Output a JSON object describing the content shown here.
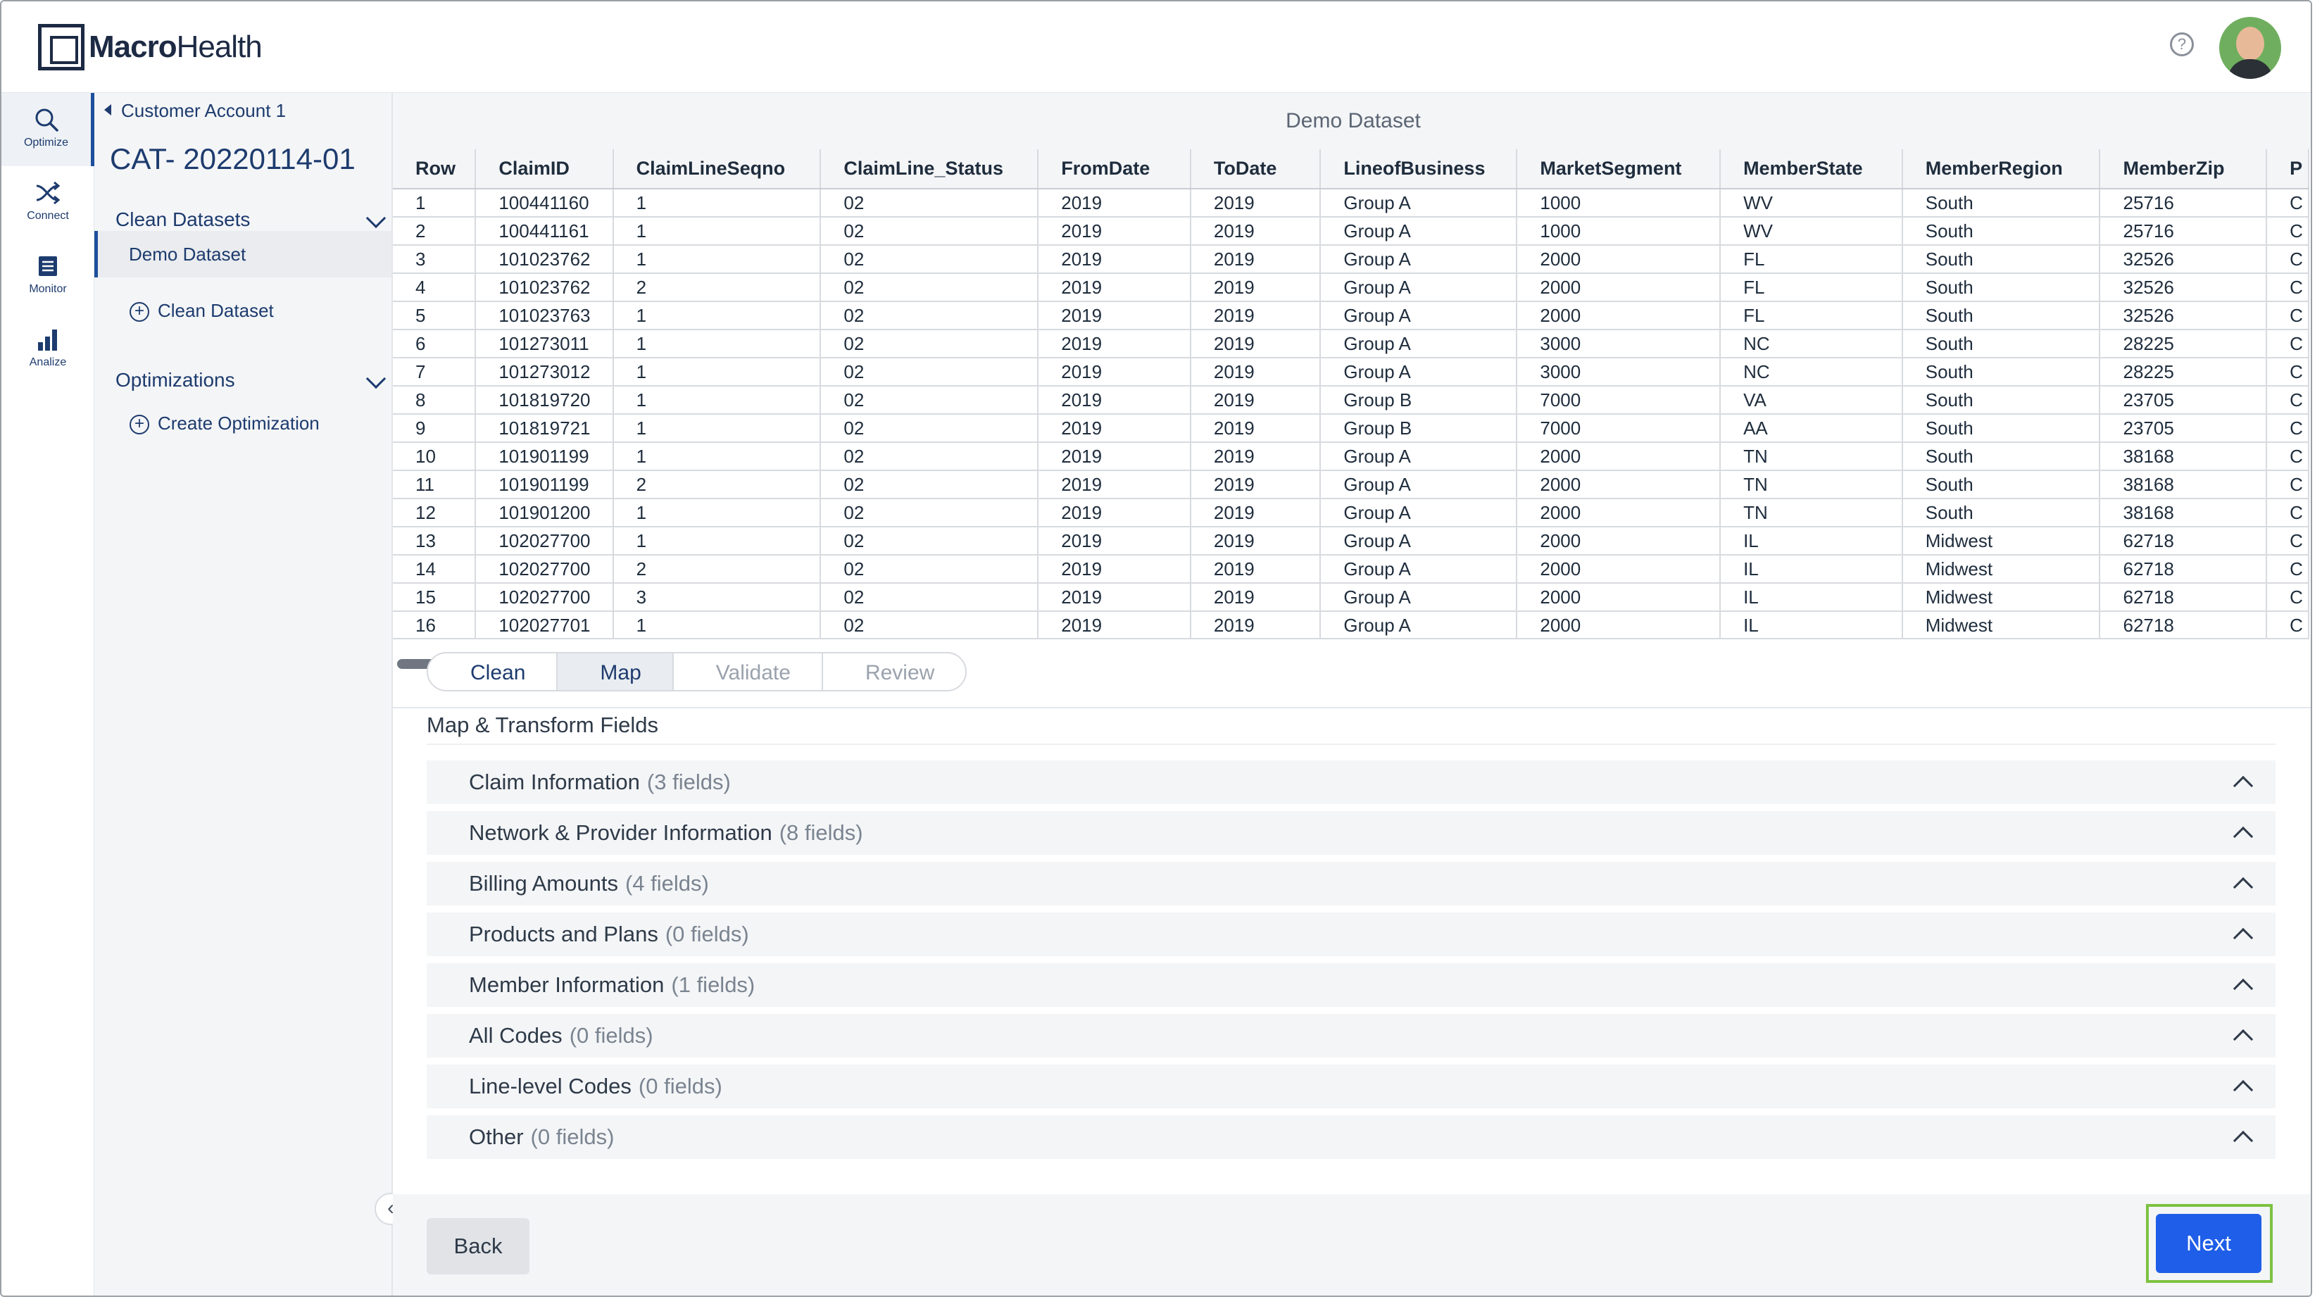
{
  "brand": {
    "name_bold": "Macro",
    "name_rest": "Health"
  },
  "header": {
    "help_icon": "question-circle-icon"
  },
  "rail": [
    {
      "label": "Optimize",
      "icon": "search-icon"
    },
    {
      "label": "Connect",
      "icon": "shuffle-icon"
    },
    {
      "label": "Monitor",
      "icon": "document-list-icon"
    },
    {
      "label": "Analize",
      "icon": "bar-chart-icon"
    }
  ],
  "subnav": {
    "breadcrumb": "Customer Account 1",
    "title": "CAT- 20220114-01",
    "sections": [
      {
        "label": "Clean Datasets",
        "items": [
          "Demo Dataset"
        ],
        "action": "Clean Dataset"
      },
      {
        "label": "Optimizations",
        "items": [],
        "action": "Create Optimization"
      }
    ]
  },
  "dataset_title": "Demo Dataset",
  "table": {
    "columns": [
      "Row",
      "ClaimID",
      "ClaimLineSeqno",
      "ClaimLine_Status",
      "FromDate",
      "ToDate",
      "LineofBusiness",
      "MarketSegment",
      "MemberState",
      "MemberRegion",
      "MemberZip",
      "P"
    ],
    "rows": [
      [
        "1",
        "100441160",
        "1",
        "02",
        "2019",
        "2019",
        "Group A",
        "1000",
        "WV",
        "South",
        "25716",
        "C"
      ],
      [
        "2",
        "100441161",
        "1",
        "02",
        "2019",
        "2019",
        "Group A",
        "1000",
        "WV",
        "South",
        "25716",
        "C"
      ],
      [
        "3",
        "101023762",
        "1",
        "02",
        "2019",
        "2019",
        "Group A",
        "2000",
        "FL",
        "South",
        "32526",
        "C"
      ],
      [
        "4",
        "101023762",
        "2",
        "02",
        "2019",
        "2019",
        "Group A",
        "2000",
        "FL",
        "South",
        "32526",
        "C"
      ],
      [
        "5",
        "101023763",
        "1",
        "02",
        "2019",
        "2019",
        "Group A",
        "2000",
        "FL",
        "South",
        "32526",
        "C"
      ],
      [
        "6",
        "101273011",
        "1",
        "02",
        "2019",
        "2019",
        "Group A",
        "3000",
        "NC",
        "South",
        "28225",
        "C"
      ],
      [
        "7",
        "101273012",
        "1",
        "02",
        "2019",
        "2019",
        "Group A",
        "3000",
        "NC",
        "South",
        "28225",
        "C"
      ],
      [
        "8",
        "101819720",
        "1",
        "02",
        "2019",
        "2019",
        "Group B",
        "7000",
        "VA",
        "South",
        "23705",
        "C"
      ],
      [
        "9",
        "101819721",
        "1",
        "02",
        "2019",
        "2019",
        "Group B",
        "7000",
        "AA",
        "South",
        "23705",
        "C"
      ],
      [
        "10",
        "101901199",
        "1",
        "02",
        "2019",
        "2019",
        "Group A",
        "2000",
        "TN",
        "South",
        "38168",
        "C"
      ],
      [
        "11",
        "101901199",
        "2",
        "02",
        "2019",
        "2019",
        "Group A",
        "2000",
        "TN",
        "South",
        "38168",
        "C"
      ],
      [
        "12",
        "101901200",
        "1",
        "02",
        "2019",
        "2019",
        "Group A",
        "2000",
        "TN",
        "South",
        "38168",
        "C"
      ],
      [
        "13",
        "102027700",
        "1",
        "02",
        "2019",
        "2019",
        "Group A",
        "2000",
        "IL",
        "Midwest",
        "62718",
        "C"
      ],
      [
        "14",
        "102027700",
        "2",
        "02",
        "2019",
        "2019",
        "Group A",
        "2000",
        "IL",
        "Midwest",
        "62718",
        "C"
      ],
      [
        "15",
        "102027700",
        "3",
        "02",
        "2019",
        "2019",
        "Group A",
        "2000",
        "IL",
        "Midwest",
        "62718",
        "C"
      ],
      [
        "16",
        "102027701",
        "1",
        "02",
        "2019",
        "2019",
        "Group A",
        "2000",
        "IL",
        "Midwest",
        "62718",
        "C"
      ]
    ]
  },
  "steps": [
    {
      "label": "Clean",
      "state": "done"
    },
    {
      "label": "Map",
      "state": "current"
    },
    {
      "label": "Validate",
      "state": "future"
    },
    {
      "label": "Review",
      "state": "future"
    }
  ],
  "map_section": {
    "title": "Map & Transform Fields",
    "groups": [
      {
        "label": "Claim Information",
        "count": "(3 fields)"
      },
      {
        "label": "Network & Provider Information",
        "count": "(8 fields)"
      },
      {
        "label": "Billing Amounts",
        "count": "(4 fields)"
      },
      {
        "label": "Products and Plans",
        "count": "(0 fields)"
      },
      {
        "label": "Member Information",
        "count": "(1 fields)"
      },
      {
        "label": "All Codes",
        "count": "(0 fields)"
      },
      {
        "label": "Line-level Codes",
        "count": "(0 fields)"
      },
      {
        "label": "Other",
        "count": "(0 fields)"
      }
    ]
  },
  "footer": {
    "back_label": "Back",
    "next_label": "Next"
  },
  "colors": {
    "brand_navy": "#1d3b6e",
    "primary_button": "#1f5ee8",
    "highlight": "#7dc242"
  }
}
